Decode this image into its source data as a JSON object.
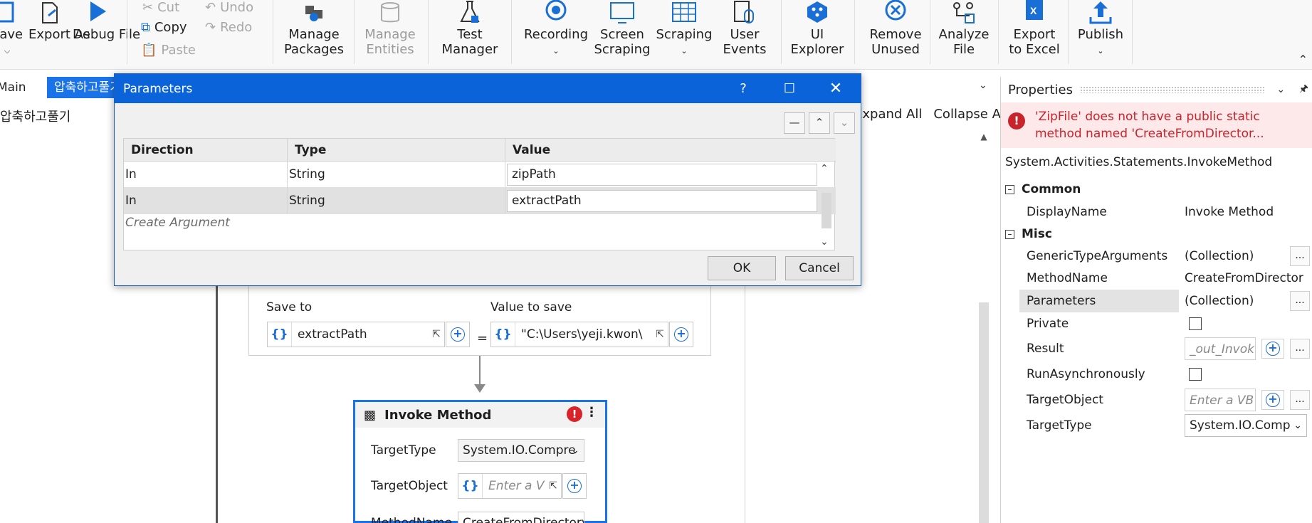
{
  "ribbon": {
    "save": "Save",
    "export_as": "Export As",
    "debug_file": "Debug File",
    "cut": "Cut",
    "copy": "Copy",
    "paste": "Paste",
    "undo": "Undo",
    "redo": "Redo",
    "manage_packages": [
      "Manage",
      "Packages"
    ],
    "manage_entities": [
      "Manage",
      "Entities"
    ],
    "test_manager": [
      "Test",
      "Manager"
    ],
    "recording": "Recording",
    "screen_scraping": [
      "Screen",
      "Scraping"
    ],
    "scraping": "Scraping",
    "user_events": [
      "User",
      "Events"
    ],
    "ui_explorer": [
      "UI",
      "Explorer"
    ],
    "remove_unused": [
      "Remove",
      "Unused"
    ],
    "analyze_file": [
      "Analyze",
      "File"
    ],
    "export_to_excel": [
      "Export",
      "to Excel"
    ],
    "publish": "Publish"
  },
  "tabs": {
    "main": "Main",
    "active": "압축하고풀기"
  },
  "breadcrumb": "압축하고풀기",
  "designer": {
    "expand_all": "Expand All",
    "collapse_all": "Collapse All",
    "assign": {
      "save_to_label": "Save to",
      "value_to_save_label": "Value to save",
      "save_to_value": "extractPath",
      "value_to_save": "\"C:\\Users\\yeji.kwon\\",
      "equals": "="
    },
    "invoke": {
      "title": "Invoke Method",
      "target_type_label": "TargetType",
      "target_type_value": "System.IO.Compre",
      "target_object_label": "TargetObject",
      "target_object_placeholder": "Enter a V",
      "method_name_label": "MethodName",
      "method_name_value": "CreateFromDirectory"
    }
  },
  "properties": {
    "title": "Properties",
    "error": [
      "'ZipFile' does not have a public static",
      "method named 'CreateFromDirector..."
    ],
    "type_name": "System.Activities.Statements.InvokeMethod",
    "category_common": "Common",
    "category_misc": "Misc",
    "rows": {
      "display_name": {
        "name": "DisplayName",
        "value": "Invoke Method"
      },
      "generic_type_arguments": {
        "name": "GenericTypeArguments",
        "value": "(Collection)"
      },
      "method_name": {
        "name": "MethodName",
        "value": "CreateFromDirector"
      },
      "parameters": {
        "name": "Parameters",
        "value": "(Collection)"
      },
      "private": {
        "name": "Private"
      },
      "result": {
        "name": "Result",
        "value": "_out_Invok"
      },
      "run_async": {
        "name": "RunAsynchronously"
      },
      "target_object": {
        "name": "TargetObject",
        "value": "Enter a VB"
      },
      "target_type": {
        "name": "TargetType",
        "value": "System.IO.Comp"
      }
    },
    "ellipsis": "..."
  },
  "dialog": {
    "title": "Parameters",
    "help": "?",
    "columns": [
      "Direction",
      "Type",
      "Value"
    ],
    "rows": [
      {
        "direction": "In",
        "type": "String",
        "value": "zipPath"
      },
      {
        "direction": "In",
        "type": "String",
        "value": "extractPath"
      }
    ],
    "create_argument": "Create Argument",
    "ok": "OK",
    "cancel": "Cancel"
  }
}
